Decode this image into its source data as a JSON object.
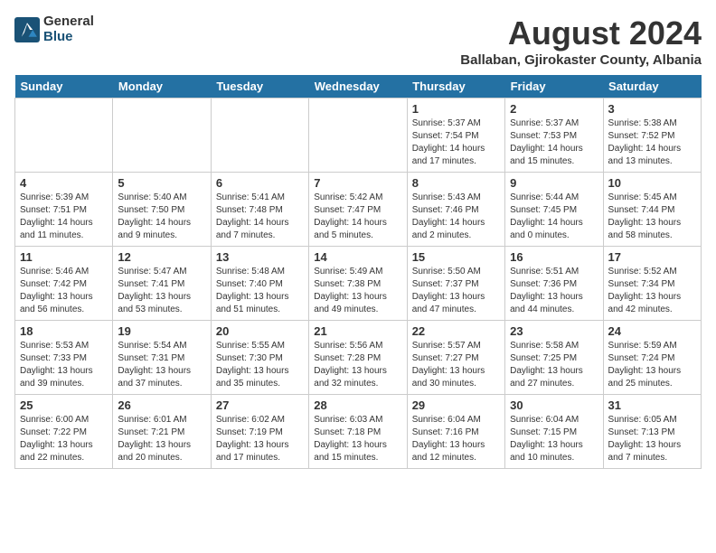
{
  "logo": {
    "general": "General",
    "blue": "Blue"
  },
  "title": "August 2024",
  "subtitle": "Ballaban, Gjirokaster County, Albania",
  "days_of_week": [
    "Sunday",
    "Monday",
    "Tuesday",
    "Wednesday",
    "Thursday",
    "Friday",
    "Saturday"
  ],
  "weeks": [
    [
      {
        "num": "",
        "info": ""
      },
      {
        "num": "",
        "info": ""
      },
      {
        "num": "",
        "info": ""
      },
      {
        "num": "",
        "info": ""
      },
      {
        "num": "1",
        "info": "Sunrise: 5:37 AM\nSunset: 7:54 PM\nDaylight: 14 hours\nand 17 minutes."
      },
      {
        "num": "2",
        "info": "Sunrise: 5:37 AM\nSunset: 7:53 PM\nDaylight: 14 hours\nand 15 minutes."
      },
      {
        "num": "3",
        "info": "Sunrise: 5:38 AM\nSunset: 7:52 PM\nDaylight: 14 hours\nand 13 minutes."
      }
    ],
    [
      {
        "num": "4",
        "info": "Sunrise: 5:39 AM\nSunset: 7:51 PM\nDaylight: 14 hours\nand 11 minutes."
      },
      {
        "num": "5",
        "info": "Sunrise: 5:40 AM\nSunset: 7:50 PM\nDaylight: 14 hours\nand 9 minutes."
      },
      {
        "num": "6",
        "info": "Sunrise: 5:41 AM\nSunset: 7:48 PM\nDaylight: 14 hours\nand 7 minutes."
      },
      {
        "num": "7",
        "info": "Sunrise: 5:42 AM\nSunset: 7:47 PM\nDaylight: 14 hours\nand 5 minutes."
      },
      {
        "num": "8",
        "info": "Sunrise: 5:43 AM\nSunset: 7:46 PM\nDaylight: 14 hours\nand 2 minutes."
      },
      {
        "num": "9",
        "info": "Sunrise: 5:44 AM\nSunset: 7:45 PM\nDaylight: 14 hours\nand 0 minutes."
      },
      {
        "num": "10",
        "info": "Sunrise: 5:45 AM\nSunset: 7:44 PM\nDaylight: 13 hours\nand 58 minutes."
      }
    ],
    [
      {
        "num": "11",
        "info": "Sunrise: 5:46 AM\nSunset: 7:42 PM\nDaylight: 13 hours\nand 56 minutes."
      },
      {
        "num": "12",
        "info": "Sunrise: 5:47 AM\nSunset: 7:41 PM\nDaylight: 13 hours\nand 53 minutes."
      },
      {
        "num": "13",
        "info": "Sunrise: 5:48 AM\nSunset: 7:40 PM\nDaylight: 13 hours\nand 51 minutes."
      },
      {
        "num": "14",
        "info": "Sunrise: 5:49 AM\nSunset: 7:38 PM\nDaylight: 13 hours\nand 49 minutes."
      },
      {
        "num": "15",
        "info": "Sunrise: 5:50 AM\nSunset: 7:37 PM\nDaylight: 13 hours\nand 47 minutes."
      },
      {
        "num": "16",
        "info": "Sunrise: 5:51 AM\nSunset: 7:36 PM\nDaylight: 13 hours\nand 44 minutes."
      },
      {
        "num": "17",
        "info": "Sunrise: 5:52 AM\nSunset: 7:34 PM\nDaylight: 13 hours\nand 42 minutes."
      }
    ],
    [
      {
        "num": "18",
        "info": "Sunrise: 5:53 AM\nSunset: 7:33 PM\nDaylight: 13 hours\nand 39 minutes."
      },
      {
        "num": "19",
        "info": "Sunrise: 5:54 AM\nSunset: 7:31 PM\nDaylight: 13 hours\nand 37 minutes."
      },
      {
        "num": "20",
        "info": "Sunrise: 5:55 AM\nSunset: 7:30 PM\nDaylight: 13 hours\nand 35 minutes."
      },
      {
        "num": "21",
        "info": "Sunrise: 5:56 AM\nSunset: 7:28 PM\nDaylight: 13 hours\nand 32 minutes."
      },
      {
        "num": "22",
        "info": "Sunrise: 5:57 AM\nSunset: 7:27 PM\nDaylight: 13 hours\nand 30 minutes."
      },
      {
        "num": "23",
        "info": "Sunrise: 5:58 AM\nSunset: 7:25 PM\nDaylight: 13 hours\nand 27 minutes."
      },
      {
        "num": "24",
        "info": "Sunrise: 5:59 AM\nSunset: 7:24 PM\nDaylight: 13 hours\nand 25 minutes."
      }
    ],
    [
      {
        "num": "25",
        "info": "Sunrise: 6:00 AM\nSunset: 7:22 PM\nDaylight: 13 hours\nand 22 minutes."
      },
      {
        "num": "26",
        "info": "Sunrise: 6:01 AM\nSunset: 7:21 PM\nDaylight: 13 hours\nand 20 minutes."
      },
      {
        "num": "27",
        "info": "Sunrise: 6:02 AM\nSunset: 7:19 PM\nDaylight: 13 hours\nand 17 minutes."
      },
      {
        "num": "28",
        "info": "Sunrise: 6:03 AM\nSunset: 7:18 PM\nDaylight: 13 hours\nand 15 minutes."
      },
      {
        "num": "29",
        "info": "Sunrise: 6:04 AM\nSunset: 7:16 PM\nDaylight: 13 hours\nand 12 minutes."
      },
      {
        "num": "30",
        "info": "Sunrise: 6:04 AM\nSunset: 7:15 PM\nDaylight: 13 hours\nand 10 minutes."
      },
      {
        "num": "31",
        "info": "Sunrise: 6:05 AM\nSunset: 7:13 PM\nDaylight: 13 hours\nand 7 minutes."
      }
    ]
  ]
}
